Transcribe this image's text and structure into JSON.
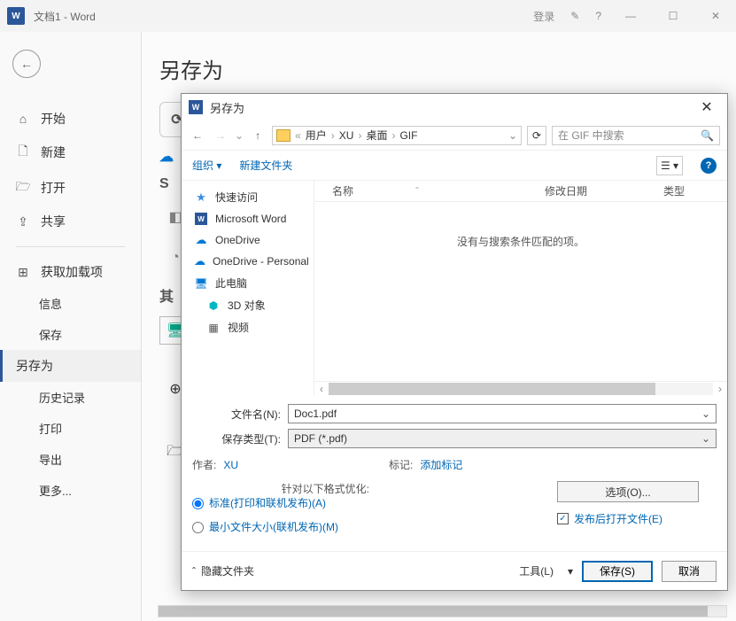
{
  "titlebar": {
    "title": "文档1 - Word",
    "login": "登录"
  },
  "left_nav": {
    "start": "开始",
    "new": "新建",
    "open": "打开",
    "share": "共享",
    "addons": "获取加载项",
    "info": "信息",
    "save": "保存",
    "save_as": "另存为",
    "history": "历史记录",
    "print": "打印",
    "export": "导出",
    "more": "更多..."
  },
  "content": {
    "heading": "另存为",
    "share_badge": "S",
    "other_badge": "其"
  },
  "dialog": {
    "title": "另存为",
    "breadcrumb": [
      "用户",
      "XU",
      "桌面",
      "GIF"
    ],
    "search_placeholder": "在 GIF 中搜索",
    "organize": "组织",
    "new_folder": "新建文件夹",
    "tree": {
      "quick": "快速访问",
      "word": "Microsoft Word",
      "onedrive": "OneDrive",
      "onedrive_p": "OneDrive - Personal",
      "this_pc": "此电脑",
      "obj3d": "3D 对象",
      "video": "视频"
    },
    "columns": {
      "name": "名称",
      "date": "修改日期",
      "type": "类型"
    },
    "empty_msg": "没有与搜索条件匹配的项。",
    "file_name_label": "文件名(N):",
    "file_name": "Doc1.pdf",
    "file_type_label": "保存类型(T):",
    "file_type": "PDF (*.pdf)",
    "author_label": "作者:",
    "author": "XU",
    "tags_label": "标记:",
    "tags": "添加标记",
    "optimize_label": "针对以下格式优化:",
    "radio_standard": "标准(打印和联机发布)(A)",
    "radio_min": "最小文件大小(联机发布)(M)",
    "options_btn": "选项(O)...",
    "open_after": "发布后打开文件(E)",
    "hide_folders": "隐藏文件夹",
    "tools": "工具(L)",
    "save_btn": "保存(S)",
    "cancel_btn": "取消"
  }
}
